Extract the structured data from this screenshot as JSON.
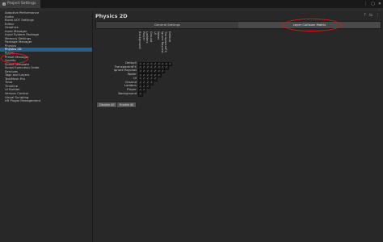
{
  "window": {
    "tab_title": "Project Settings",
    "controls": [
      "⋮",
      "▢",
      "✕"
    ],
    "menu": "⋮"
  },
  "sidebar": {
    "items": [
      {
        "label": "Adaptive Performance",
        "active": false
      },
      {
        "label": "Audio",
        "active": false
      },
      {
        "label": "Burst AOT Settings",
        "active": false
      },
      {
        "label": "Editor",
        "active": false
      },
      {
        "label": "Graphics",
        "active": false
      },
      {
        "label": "Input Manager",
        "active": false
      },
      {
        "label": "Input System Package",
        "active": false
      },
      {
        "label": "Memory Settings",
        "active": false
      },
      {
        "label": "Package Manager",
        "active": false
      },
      {
        "label": "Physics",
        "active": false
      },
      {
        "label": "Physics 2D",
        "active": true
      },
      {
        "label": "Player",
        "active": false
      },
      {
        "label": "Preset Manager",
        "active": false
      },
      {
        "label": "Quality",
        "active": false
      },
      {
        "label": "Scene Template",
        "active": false
      },
      {
        "label": "Script Execution Order",
        "active": false
      },
      {
        "label": "Services",
        "active": false
      },
      {
        "label": "Tags and Layers",
        "active": false
      },
      {
        "label": "TextMesh Pro",
        "active": false
      },
      {
        "label": "Time",
        "active": false
      },
      {
        "label": "Timeline",
        "active": false
      },
      {
        "label": "UI Builder",
        "active": false
      },
      {
        "label": "Version Control",
        "active": false
      },
      {
        "label": "Visual Scripting",
        "active": false
      },
      {
        "label": "XR Plugin Management",
        "active": false
      }
    ]
  },
  "main": {
    "title": "Physics 2D",
    "header_icons": [
      "?",
      "⇆",
      "⋮"
    ],
    "tabs": [
      {
        "label": "General Settings",
        "selected": false
      },
      {
        "label": "Layer Collision Matrix",
        "selected": true
      }
    ],
    "matrix": {
      "layers": [
        "Default",
        "TransparentFX",
        "Ignore Raycast",
        "Water",
        "UI",
        "Ground",
        "Ladders",
        "Player",
        "Background"
      ],
      "check_glyph": "✓"
    },
    "buttons": {
      "disable_all": "Disable All",
      "enable_all": "Enable All"
    }
  },
  "annotations": {
    "color": "#d41a1a"
  }
}
